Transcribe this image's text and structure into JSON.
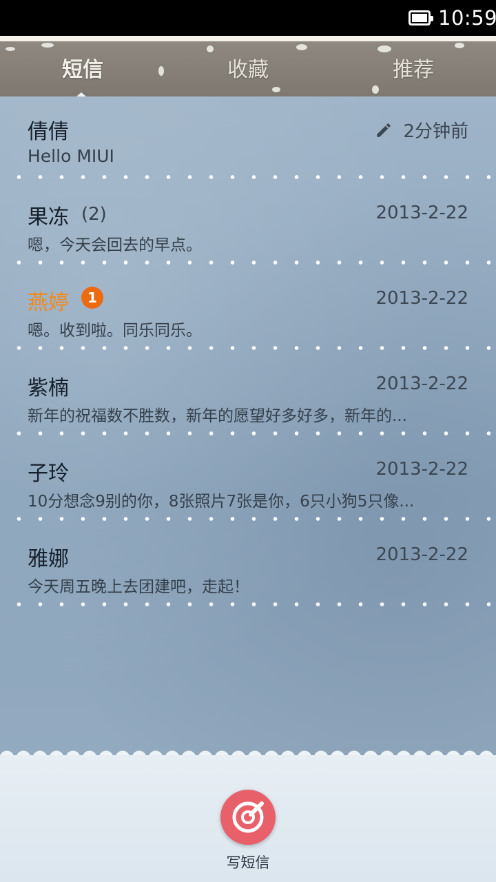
{
  "status_bar": {
    "time": "10:59"
  },
  "tabs": [
    {
      "label": "短信",
      "active": true
    },
    {
      "label": "收藏",
      "active": false
    },
    {
      "label": "推荐",
      "active": false
    }
  ],
  "conversations": [
    {
      "name": "倩倩",
      "count": "",
      "unread_badge": "",
      "time": "2分钟前",
      "draft": true,
      "snippet": "Hello MIUI"
    },
    {
      "name": "果冻",
      "count": "(2)",
      "unread_badge": "",
      "time": "2013-2-22",
      "draft": false,
      "snippet": "嗯，今天会回去的早点。"
    },
    {
      "name": "燕婷",
      "count": "",
      "unread_badge": "1",
      "time": "2013-2-22",
      "draft": false,
      "snippet": "嗯。收到啦。同乐同乐。"
    },
    {
      "name": "紫楠",
      "count": "",
      "unread_badge": "",
      "time": "2013-2-22",
      "draft": false,
      "snippet": "新年的祝福数不胜数，新年的愿望好多好多，新年的..."
    },
    {
      "name": "子玲",
      "count": "",
      "unread_badge": "",
      "time": "2013-2-22",
      "draft": false,
      "snippet": "10分想念9别的你，8张照片7张是你，6只小狗5只像..."
    },
    {
      "name": "雅娜",
      "count": "",
      "unread_badge": "",
      "time": "2013-2-22",
      "draft": false,
      "snippet": "今天周五晚上去团建吧，走起！"
    }
  ],
  "compose": {
    "label": "写短信",
    "icon": "compose-icon",
    "color": "#e8606a"
  },
  "colors": {
    "unread_name": "#f08a1e",
    "badge": "#ec6a10"
  }
}
